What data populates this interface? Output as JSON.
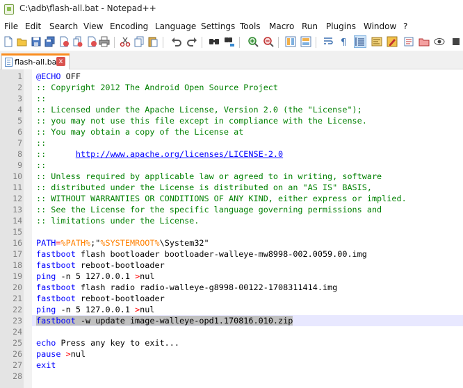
{
  "window": {
    "title": "C:\\adb\\flash-all.bat - Notepad++"
  },
  "menu": [
    "File",
    "Edit",
    "Search",
    "View",
    "Encoding",
    "Language",
    "Settings",
    "Tools",
    "Macro",
    "Run",
    "Plugins",
    "Window",
    "?"
  ],
  "toolbar": {
    "icons": [
      "new-file-icon",
      "open-file-icon",
      "save-icon",
      "save-all-icon",
      "close-icon",
      "close-all-icon",
      "print-icon",
      "cut-icon",
      "copy-icon",
      "paste-icon",
      "undo-icon",
      "redo-icon",
      "find-icon",
      "replace-icon",
      "zoom-in-icon",
      "zoom-out-icon",
      "sync-vertical-icon",
      "sync-horizontal-icon",
      "word-wrap-icon",
      "show-all-chars-icon",
      "indent-guide-icon",
      "doc-map-icon",
      "function-list-icon",
      "folder-workspace-icon",
      "monitoring-icon",
      "macro-record-icon"
    ]
  },
  "tabs": [
    {
      "label": "flash-all.bat",
      "close": "x"
    }
  ],
  "editor": {
    "current_line": 23,
    "lines": [
      [
        {
          "t": "@ECHO",
          "c": "kw"
        },
        {
          "t": " OFF",
          "c": ""
        }
      ],
      [
        {
          "t": ":: Copyright 2012 The Android Open Source Project",
          "c": "comment"
        }
      ],
      [
        {
          "t": "::",
          "c": "comment"
        }
      ],
      [
        {
          "t": ":: Licensed under the Apache License, Version 2.0 (the \"License\");",
          "c": "comment"
        }
      ],
      [
        {
          "t": ":: you may not use this file except in compliance with the License.",
          "c": "comment"
        }
      ],
      [
        {
          "t": ":: You may obtain a copy of the License at",
          "c": "comment"
        }
      ],
      [
        {
          "t": "::",
          "c": "comment"
        }
      ],
      [
        {
          "t": "::      ",
          "c": "comment"
        },
        {
          "t": "http://www.apache.org/licenses/LICENSE-2.0",
          "c": "url"
        }
      ],
      [
        {
          "t": "::",
          "c": "comment"
        }
      ],
      [
        {
          "t": ":: Unless required by applicable law or agreed to in writing, software",
          "c": "comment"
        }
      ],
      [
        {
          "t": ":: distributed under the License is distributed on an \"AS IS\" BASIS,",
          "c": "comment"
        }
      ],
      [
        {
          "t": ":: WITHOUT WARRANTIES OR CONDITIONS OF ANY KIND, either express or implied.",
          "c": "comment"
        }
      ],
      [
        {
          "t": ":: See the License for the specific language governing permissions and",
          "c": "comment"
        }
      ],
      [
        {
          "t": ":: limitations under the License.",
          "c": "comment"
        }
      ],
      [],
      [
        {
          "t": "PATH",
          "c": "kw"
        },
        {
          "t": "=",
          "c": "op"
        },
        {
          "t": "%PATH%",
          "c": "var"
        },
        {
          "t": ";\"",
          "c": ""
        },
        {
          "t": "%SYSTEMROOT%",
          "c": "var"
        },
        {
          "t": "\\System32\"",
          "c": ""
        }
      ],
      [
        {
          "t": "fastboot",
          "c": "kw"
        },
        {
          "t": " flash bootloader bootloader-walleye-mw8998-002.0059.00.img",
          "c": ""
        }
      ],
      [
        {
          "t": "fastboot",
          "c": "kw"
        },
        {
          "t": " reboot-bootloader",
          "c": ""
        }
      ],
      [
        {
          "t": "ping",
          "c": "kw"
        },
        {
          "t": " -n 5 127.0.0.1 ",
          "c": ""
        },
        {
          "t": ">",
          "c": "op"
        },
        {
          "t": "nul",
          "c": ""
        }
      ],
      [
        {
          "t": "fastboot",
          "c": "kw"
        },
        {
          "t": " flash radio radio-walleye-g8998-00122-1708311414.img",
          "c": ""
        }
      ],
      [
        {
          "t": "fastboot",
          "c": "kw"
        },
        {
          "t": " reboot-bootloader",
          "c": ""
        }
      ],
      [
        {
          "t": "ping",
          "c": "kw"
        },
        {
          "t": " -n 5 127.0.0.1 ",
          "c": ""
        },
        {
          "t": ">",
          "c": "op"
        },
        {
          "t": "nul",
          "c": ""
        }
      ],
      [
        {
          "t": "fastboot",
          "c": "kw",
          "s": 1
        },
        {
          "t": " -w update image-walleye-opd1.170816.010.zip",
          "c": "",
          "s": 1
        }
      ],
      [],
      [
        {
          "t": "echo",
          "c": "kw"
        },
        {
          "t": " Press any key to exit...",
          "c": ""
        }
      ],
      [
        {
          "t": "pause",
          "c": "kw"
        },
        {
          "t": " ",
          "c": ""
        },
        {
          "t": ">",
          "c": "op"
        },
        {
          "t": "nul",
          "c": ""
        }
      ],
      [
        {
          "t": "exit",
          "c": "kw"
        }
      ],
      []
    ]
  }
}
